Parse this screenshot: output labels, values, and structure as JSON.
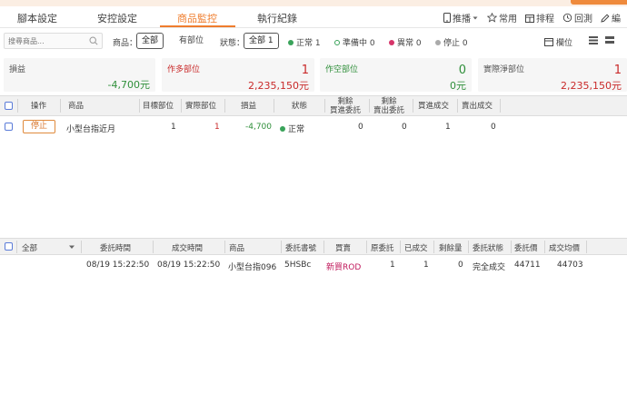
{
  "tabs": [
    {
      "label": "腳本設定"
    },
    {
      "label": "安控設定"
    },
    {
      "label": "商品監控"
    },
    {
      "label": "執行紀錄"
    }
  ],
  "toolbar": {
    "push_label": "推播",
    "favorites_label": "常用",
    "schedule_label": "排程",
    "backtest_label": "回測",
    "edit_label": "編"
  },
  "filters": {
    "search_placeholder": "搜尋商品...",
    "product_label": "商品：",
    "product_all": "全部",
    "product_has_position": "有部位",
    "status_label": "狀態：",
    "status_all": "全部 1",
    "status_normal": "正常 1",
    "status_preparing": "準備中 0",
    "status_abnormal": "異常 0",
    "status_stopped": "停止 0",
    "columns_label": "欄位"
  },
  "summary": {
    "pnl": {
      "label": "損益",
      "value": "-4,700元"
    },
    "long": {
      "label": "作多部位",
      "count": "1",
      "value": "2,235,150元"
    },
    "short": {
      "label": "作空部位",
      "count": "0",
      "value": "0元"
    },
    "net": {
      "label": "實際淨部位",
      "count": "1",
      "value": "2,235,150元"
    }
  },
  "monitor_table": {
    "headers": {
      "action": "操作",
      "product": "商品",
      "target_pos": "目標部位",
      "actual_pos": "實際部位",
      "pnl": "損益",
      "status": "狀態",
      "rem_buy_1": "剩餘",
      "rem_buy_2": "買進委託",
      "rem_sell_1": "剩餘",
      "rem_sell_2": "賣出委託",
      "buy_filled": "買進成交",
      "sell_filled": "賣出成交"
    },
    "rows": [
      {
        "action": "停止",
        "product": "小型台指近月",
        "target_pos": "1",
        "actual_pos": "1",
        "pnl": "-4,700",
        "status": "正常",
        "rem_buy": "0",
        "rem_sell": "0",
        "buy_filled": "1",
        "sell_filled": "0"
      }
    ]
  },
  "order_table": {
    "filter_value": "全部",
    "headers": {
      "order_time": "委託時間",
      "fill_time": "成交時間",
      "product": "商品",
      "order_no": "委託書號",
      "side": "買賣",
      "orig_qty": "原委託",
      "filled": "已成交",
      "remain": "剩餘量",
      "order_status": "委託狀態",
      "order_price": "委託價",
      "avg_price": "成交均價"
    },
    "rows": [
      {
        "order_time": "08/19 15:22:50",
        "fill_time": "08/19 15:22:50",
        "product": "小型台指096",
        "order_no": "5HSBc",
        "side": "新買ROD",
        "orig_qty": "1",
        "filled": "1",
        "remain": "0",
        "order_status": "完全成交",
        "order_price": "44711",
        "avg_price": "44703"
      }
    ]
  },
  "colors": {
    "accent": "#ef7d2d",
    "loss_green": "#2f8f3a",
    "long_red": "#c92a2a",
    "buy_text": "#c0185b"
  }
}
